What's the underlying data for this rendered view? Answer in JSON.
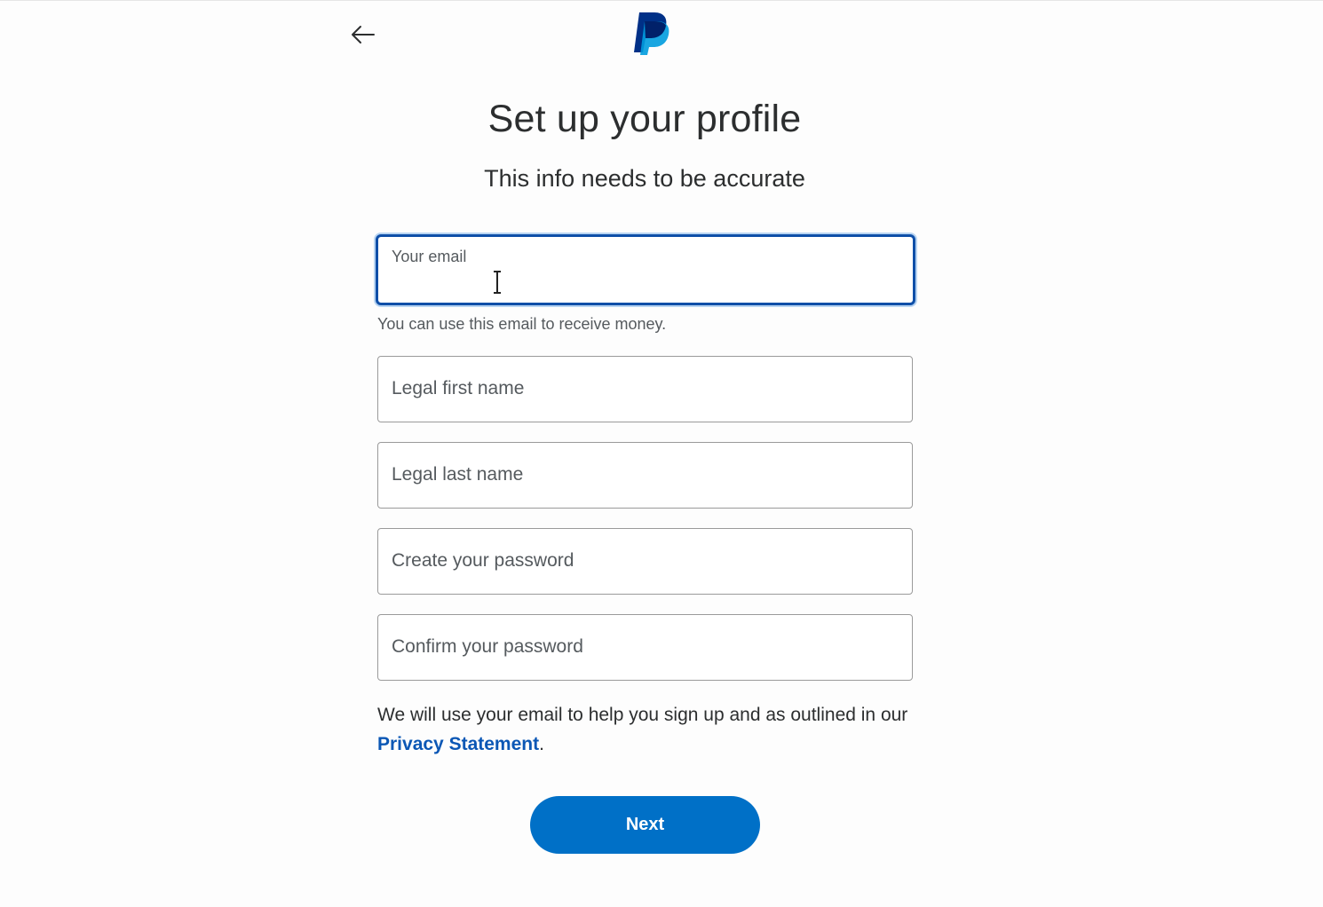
{
  "header": {
    "back_icon": "arrow-left-icon",
    "logo_icon": "paypal-logo-icon"
  },
  "title": "Set up your profile",
  "subtitle": "This info needs to be accurate",
  "form": {
    "email": {
      "label": "Your email",
      "value": "",
      "helper": "You can use this email to receive money."
    },
    "first_name": {
      "label": "Legal first name",
      "value": ""
    },
    "last_name": {
      "label": "Legal last name",
      "value": ""
    },
    "password": {
      "label": "Create your password",
      "value": ""
    },
    "confirm_password": {
      "label": "Confirm your password",
      "value": ""
    }
  },
  "legal": {
    "text_before": "We will use your email to help you sign up and as outlined in our ",
    "link": "Privacy Statement",
    "text_after": "."
  },
  "next_button": {
    "label": "Next"
  },
  "colors": {
    "brand_dark": "#003087",
    "brand_light": "#009cde",
    "button": "#0070c7",
    "focus_border": "#0f4fa8",
    "link": "#0b57b5"
  }
}
